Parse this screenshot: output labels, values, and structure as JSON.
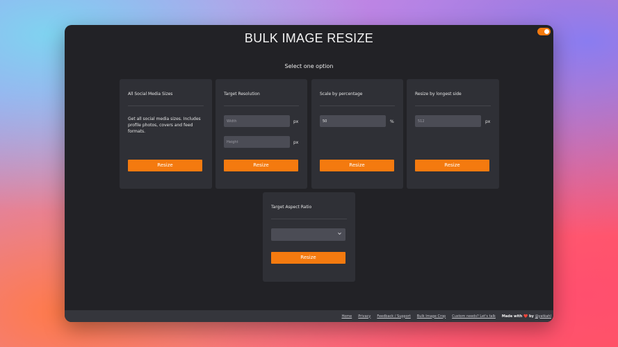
{
  "app": {
    "title": "BULK IMAGE RESIZE",
    "subtitle": "Select one option",
    "accent_color": "#f47a0f",
    "theme_toggle_on": true
  },
  "cards": {
    "social": {
      "title": "All Social Media Sizes",
      "description": "Get all social media sizes. Includes profile photos, covers and feed formats.",
      "button": "Resize"
    },
    "resolution": {
      "title": "Target Resolution",
      "width_placeholder": "Width",
      "height_placeholder": "Height",
      "unit": "px",
      "button": "Resize"
    },
    "percentage": {
      "title": "Scale by percentage",
      "value": "50",
      "unit": "%",
      "button": "Resize"
    },
    "longest": {
      "title": "Resize by longest side",
      "placeholder": "512",
      "unit": "px",
      "button": "Resize"
    },
    "aspect": {
      "title": "Target Aspect Ratio",
      "selected": "",
      "chevron_icon": "chevron-down-icon",
      "button": "Resize"
    }
  },
  "footer": {
    "links": [
      "Home",
      "Privacy",
      "Feedback / Support",
      "Bulk Image Crop",
      "Custom needs? Let's talk"
    ],
    "made_with_prefix": "Made with",
    "heart": "❤️",
    "made_with_by": "by",
    "handle": "@yatkahl"
  }
}
